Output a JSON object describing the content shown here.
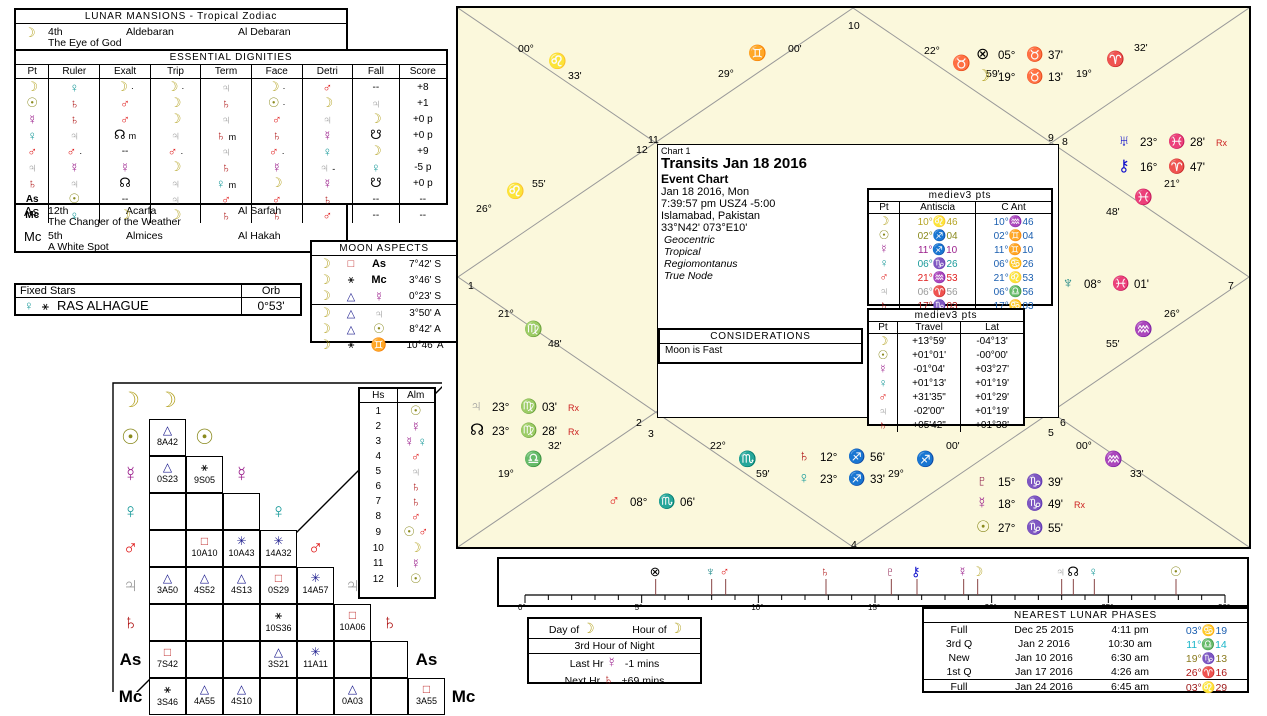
{
  "lunar_mansions": {
    "title": "LUNAR MANSIONS - Tropical Zodiac",
    "rows": [
      {
        "pt": "moon",
        "num": "4th",
        "name": "Aldebaran",
        "alt": "Al Debaran",
        "desc": "The Eye of God"
      },
      {
        "pt": "As",
        "num": "12th",
        "name": "Acarfa",
        "alt": "Al Sarfah",
        "desc": "The Changer of the Weather"
      },
      {
        "pt": "Mc",
        "num": "5th",
        "name": "Almices",
        "alt": "Al Hakah",
        "desc": "A White Spot"
      }
    ]
  },
  "essential_dignities": {
    "title": "ESSENTIAL DIGNITIES",
    "headers": [
      "Pt",
      "Ruler",
      "Exalt",
      "Trip",
      "Term",
      "Face",
      "Detri",
      "Fall",
      "Score"
    ],
    "rows": [
      {
        "pt": "moon",
        "ruler": "venus",
        "exalt": "moon",
        "exalt_m": "·",
        "trip": "moon",
        "trip_m": "·",
        "term": "jupiter",
        "face": "moon",
        "face_m": "·",
        "detri": "mars",
        "fall": "--",
        "score": "+8"
      },
      {
        "pt": "sun",
        "ruler": "saturn",
        "exalt": "mars",
        "trip": "moon",
        "term": "saturn",
        "face": "sun",
        "face_m": "·",
        "detri": "moon",
        "fall": "jupiter",
        "score": "+1"
      },
      {
        "pt": "mercury",
        "ruler": "saturn",
        "exalt": "mars",
        "trip": "moon",
        "term": "jupiter",
        "face": "mars",
        "detri": "jupiter",
        "fall": "moon",
        "score": "+0 p"
      },
      {
        "pt": "venus",
        "ruler": "jupiter",
        "exalt": "node",
        "exalt_m": "m",
        "trip": "jupiter",
        "term": "saturn",
        "term_m": "m",
        "face": "saturn",
        "detri": "mercury",
        "fall": "southnode",
        "score": "+0 p"
      },
      {
        "pt": "mars",
        "ruler": "mars",
        "ruler_m": "·",
        "exalt": "--",
        "trip": "mars",
        "trip_m": "·",
        "term": "jupiter",
        "face": "mars",
        "face_m": "·",
        "detri": "venus",
        "fall": "moon",
        "score": "+9"
      },
      {
        "pt": "jupiter",
        "ruler": "mercury",
        "exalt": "mercury",
        "trip": "moon",
        "term": "saturn",
        "face": "mercury",
        "detri": "jupiter",
        "detri_m": "-",
        "fall": "venus",
        "score": "-5 p"
      },
      {
        "pt": "saturn",
        "ruler": "jupiter",
        "exalt": "node",
        "trip": "jupiter",
        "term": "venus",
        "term_m": "m",
        "face": "moon",
        "detri": "mercury",
        "fall": "southnode",
        "score": "+0 p"
      },
      {
        "pt": "As",
        "ruler": "sun",
        "exalt": "--",
        "trip": "jupiter",
        "term": "mars",
        "face": "mars",
        "detri": "saturn",
        "fall": "--",
        "score": "--"
      },
      {
        "pt": "Mc",
        "ruler": "venus",
        "exalt": "moon",
        "trip": "moon",
        "term": "saturn",
        "face": "saturn",
        "detri": "mars",
        "fall": "--",
        "score": "--"
      }
    ]
  },
  "fixed_stars": {
    "col1": "Fixed Stars",
    "col2": "Orb",
    "rows": [
      {
        "pt": "venus",
        "aspect": "conjunct",
        "star": "RAS ALHAGUE",
        "orb": "0°53'"
      }
    ]
  },
  "moon_aspects": {
    "title": "MOON ASPECTS",
    "rows": [
      {
        "p1": "moon",
        "asp": "square",
        "p2": "As",
        "orb": "7°42' S"
      },
      {
        "p1": "moon",
        "asp": "conjunct",
        "p2": "Mc",
        "orb": "3°46' S"
      },
      {
        "p1": "moon",
        "asp": "trine",
        "p2": "mercury",
        "orb": "0°23' S"
      },
      {
        "p1": "moon",
        "asp": "trine",
        "p2": "jupiter",
        "orb": "3°50' A"
      },
      {
        "p1": "moon",
        "asp": "trine",
        "p2": "sun",
        "orb": "8°42' A"
      },
      {
        "p1": "moon",
        "asp": "conjunct",
        "p2": "gemini",
        "orb": "10°46' A"
      }
    ]
  },
  "aspect_grid": {
    "points": [
      "moon",
      "sun",
      "mercury",
      "venus",
      "mars",
      "jupiter",
      "saturn",
      "As",
      "Mc"
    ],
    "cells": [
      {
        "row": 1,
        "col": 0,
        "asp": "trine",
        "val": "8A42"
      },
      {
        "row": 2,
        "col": 0,
        "asp": "trine",
        "val": "0S23"
      },
      {
        "row": 2,
        "col": 1,
        "asp": "conjunct",
        "val": "9S05"
      },
      {
        "row": 4,
        "col": 1,
        "asp": "square",
        "val": "10A10"
      },
      {
        "row": 4,
        "col": 2,
        "asp": "sextile",
        "val": "10A43"
      },
      {
        "row": 4,
        "col": 3,
        "asp": "sextile",
        "val": "14A32"
      },
      {
        "row": 5,
        "col": 0,
        "asp": "trine",
        "val": "3A50"
      },
      {
        "row": 5,
        "col": 1,
        "asp": "trine",
        "val": "4S52"
      },
      {
        "row": 5,
        "col": 2,
        "asp": "trine",
        "val": "4S13"
      },
      {
        "row": 5,
        "col": 3,
        "asp": "square",
        "val": "0S29"
      },
      {
        "row": 5,
        "col": 4,
        "asp": "sextile",
        "val": "14A57"
      },
      {
        "row": 6,
        "col": 3,
        "asp": "conjunct",
        "val": "10S36"
      },
      {
        "row": 6,
        "col": 5,
        "asp": "square",
        "val": "10A06"
      },
      {
        "row": 7,
        "col": 0,
        "asp": "square",
        "val": "7S42"
      },
      {
        "row": 7,
        "col": 3,
        "asp": "trine",
        "val": "3S21"
      },
      {
        "row": 7,
        "col": 4,
        "asp": "sextile",
        "val": "11A11"
      },
      {
        "row": 8,
        "col": 0,
        "asp": "conjunct",
        "val": "3S46"
      },
      {
        "row": 8,
        "col": 1,
        "asp": "trine",
        "val": "4A55"
      },
      {
        "row": 8,
        "col": 2,
        "asp": "trine",
        "val": "4S10"
      },
      {
        "row": 8,
        "col": 5,
        "asp": "trine",
        "val": "0A03"
      },
      {
        "row": 8,
        "col": 7,
        "asp": "square",
        "val": "3A55"
      }
    ]
  },
  "almuten_table": {
    "headers": [
      "Hs",
      "Alm"
    ],
    "rows": [
      {
        "hs": "1",
        "alm": [
          "sun"
        ]
      },
      {
        "hs": "2",
        "alm": [
          "mercury"
        ]
      },
      {
        "hs": "3",
        "alm": [
          "mercury",
          "venus"
        ]
      },
      {
        "hs": "4",
        "alm": [
          "mars"
        ]
      },
      {
        "hs": "5",
        "alm": [
          "jupiter"
        ]
      },
      {
        "hs": "6",
        "alm": [
          "saturn"
        ]
      },
      {
        "hs": "7",
        "alm": [
          "saturn"
        ]
      },
      {
        "hs": "8",
        "alm": [
          "mars"
        ]
      },
      {
        "hs": "9",
        "alm": [
          "sun",
          "mars"
        ]
      },
      {
        "hs": "10",
        "alm": [
          "moon"
        ]
      },
      {
        "hs": "11",
        "alm": [
          "mercury"
        ]
      },
      {
        "hs": "12",
        "alm": [
          "sun"
        ]
      }
    ]
  },
  "chart_info": {
    "label": "Chart 1",
    "title": "Transits Jan 18 2016",
    "subtitle": "Event Chart",
    "date": "Jan 18 2016, Mon",
    "time": "7:39:57 pm  USZ4 -5:00",
    "place": "Islamabad, Pakistan",
    "coords": "33°N42' 073°E10'",
    "settings": [
      "Geocentric",
      "Tropical",
      "Regiomontanus",
      "True Node"
    ]
  },
  "considerations": {
    "title": "CONSIDERATIONS",
    "items": [
      "Moon is Fast"
    ]
  },
  "antiscia": {
    "title": "mediev3 pts",
    "headers": [
      "Pt",
      "Antiscia",
      "C Ant"
    ],
    "rows": [
      {
        "pt": "moon",
        "ant": "10°",
        "ant_sign": "leo",
        "ant_min": "46",
        "cant": "10°",
        "cant_sign": "aquarius",
        "cant_min": "46"
      },
      {
        "pt": "sun",
        "ant": "02°",
        "ant_sign": "sagittarius",
        "ant_min": "04",
        "cant": "02°",
        "cant_sign": "gemini",
        "cant_min": "04"
      },
      {
        "pt": "mercury",
        "ant": "11°",
        "ant_sign": "sagittarius",
        "ant_min": "10",
        "cant": "11°",
        "cant_sign": "gemini",
        "cant_min": "10"
      },
      {
        "pt": "venus",
        "ant": "06°",
        "ant_sign": "capricorn",
        "ant_min": "26",
        "cant": "06°",
        "cant_sign": "cancer",
        "cant_min": "26"
      },
      {
        "pt": "mars",
        "ant": "21°",
        "ant_sign": "aquarius",
        "ant_min": "53",
        "cant": "21°",
        "cant_sign": "leo",
        "cant_min": "53"
      },
      {
        "pt": "jupiter",
        "ant": "06°",
        "ant_sign": "aries",
        "ant_min": "56",
        "cant": "06°",
        "cant_sign": "libra",
        "cant_min": "56"
      },
      {
        "pt": "saturn",
        "ant": "17°",
        "ant_sign": "capricorn",
        "ant_min": "03",
        "cant": "17°",
        "cant_sign": "cancer",
        "cant_min": "03"
      }
    ]
  },
  "travel": {
    "title": "mediev3 pts",
    "headers": [
      "Pt",
      "Travel",
      "Lat"
    ],
    "rows": [
      {
        "pt": "moon",
        "travel": "+13°59'",
        "lat": "-04°13'"
      },
      {
        "pt": "sun",
        "travel": "+01°01'",
        "lat": "-00°00'"
      },
      {
        "pt": "mercury",
        "travel": "-01°04'",
        "lat": "+03°27'"
      },
      {
        "pt": "venus",
        "travel": "+01°13'",
        "lat": "+01°19'"
      },
      {
        "pt": "mars",
        "travel": "+31'35\"",
        "lat": "+01°29'"
      },
      {
        "pt": "jupiter",
        "travel": "-02'00\"",
        "lat": "+01°19'"
      },
      {
        "pt": "saturn",
        "travel": "+05'42\"",
        "lat": "+01°38'"
      }
    ]
  },
  "wheel": {
    "house_numbers": [
      "1",
      "2",
      "3",
      "4",
      "5",
      "6",
      "7",
      "8",
      "9",
      "10",
      "11",
      "12"
    ],
    "cusps": [
      {
        "house": "10",
        "deg": "22°",
        "sign": "taurus",
        "min": "59'"
      },
      {
        "house": "11",
        "deg": "29°",
        "sign": "gemini",
        "min": "00'"
      },
      {
        "house": "12",
        "deg": "00°",
        "sign": "leo",
        "min": "33'"
      },
      {
        "house": "1",
        "deg": "26°",
        "sign": "leo",
        "min": "55'"
      },
      {
        "house": "2",
        "deg": "21°",
        "sign": "virgo",
        "min": "48'"
      },
      {
        "house": "3",
        "deg": "19°",
        "sign": "libra",
        "min": "32'"
      },
      {
        "house": "4",
        "deg": "22°",
        "sign": "scorpio",
        "min": "59'"
      },
      {
        "house": "5",
        "deg": "29°",
        "sign": "sagittarius",
        "min": "00'"
      },
      {
        "house": "6",
        "deg": "00°",
        "sign": "aquarius",
        "min": "33'"
      },
      {
        "house": "7",
        "deg": "26°",
        "sign": "aquarius",
        "min": "55'"
      },
      {
        "house": "8",
        "deg": "21°",
        "sign": "pisces",
        "min": "48'"
      },
      {
        "house": "9",
        "deg": "19°",
        "sign": "aries",
        "min": "32'"
      }
    ],
    "planets": [
      {
        "pt": "partfortune",
        "deg": "05°",
        "sign": "taurus",
        "min": "37'",
        "rx": ""
      },
      {
        "pt": "moon",
        "deg": "19°",
        "sign": "taurus",
        "min": "13'",
        "rx": ""
      },
      {
        "pt": "uranus",
        "deg": "23°",
        "sign": "pisces",
        "min": "28'",
        "rx": "Rx"
      },
      {
        "pt": "chiron",
        "deg": "16°",
        "sign": "aries",
        "min": "47'",
        "rx": ""
      },
      {
        "pt": "neptune",
        "deg": "08°",
        "sign": "pisces",
        "min": "01'",
        "rx": ""
      },
      {
        "pt": "pluto",
        "deg": "15°",
        "sign": "capricorn",
        "min": "39'",
        "rx": ""
      },
      {
        "pt": "mercury",
        "deg": "18°",
        "sign": "capricorn",
        "min": "49'",
        "rx": "Rx"
      },
      {
        "pt": "sun",
        "deg": "27°",
        "sign": "capricorn",
        "min": "55'",
        "rx": ""
      },
      {
        "pt": "saturn",
        "deg": "12°",
        "sign": "sagittarius",
        "min": "56'",
        "rx": ""
      },
      {
        "pt": "venus",
        "deg": "23°",
        "sign": "sagittarius",
        "min": "33'",
        "rx": ""
      },
      {
        "pt": "mars",
        "deg": "08°",
        "sign": "scorpio",
        "min": "06'",
        "rx": ""
      },
      {
        "pt": "jupiter",
        "deg": "23°",
        "sign": "virgo",
        "min": "03'",
        "rx": "Rx"
      },
      {
        "pt": "northnode",
        "deg": "23°",
        "sign": "virgo",
        "min": "28'",
        "rx": "Rx"
      }
    ]
  },
  "dial": {
    "ticks": [
      "0°",
      "5°",
      "10°",
      "15°",
      "20°",
      "25°",
      "30°"
    ],
    "markers": [
      {
        "pt": "partfortune",
        "pos": 5.6
      },
      {
        "pt": "neptune",
        "pos": 8.0
      },
      {
        "pt": "mars",
        "pos": 8.6
      },
      {
        "pt": "saturn",
        "pos": 12.9
      },
      {
        "pt": "pluto",
        "pos": 15.7
      },
      {
        "pt": "chiron",
        "pos": 16.8
      },
      {
        "pt": "mercury",
        "pos": 18.8
      },
      {
        "pt": "moon",
        "pos": 19.4
      },
      {
        "pt": "jupiter",
        "pos": 23.0
      },
      {
        "pt": "northnode",
        "pos": 23.5
      },
      {
        "pt": "venus",
        "pos": 24.4
      },
      {
        "pt": "sun",
        "pos": 27.9
      }
    ]
  },
  "hour_panel": {
    "day_of_label": "Day of",
    "day_of_pt": "moon",
    "hour_of_label": "Hour of",
    "hour_of_pt": "moon",
    "current": "3rd Hour of Night",
    "last_label": "Last Hr",
    "last_pt": "mercury",
    "last_val": "-1 mins",
    "next_label": "Next Hr",
    "next_pt": "saturn",
    "next_val": "+69 mins"
  },
  "lunar_phases": {
    "title": "NEAREST LUNAR PHASES",
    "rows": [
      {
        "phase": "Full",
        "date": "Dec 25 2015",
        "time": "4:11 pm",
        "deg": "03°",
        "sign": "cancer",
        "min": "19"
      },
      {
        "phase": "3rd Q",
        "date": "Jan 2 2016",
        "time": "10:30 am",
        "deg": "11°",
        "sign": "libra",
        "min": "14"
      },
      {
        "phase": "New",
        "date": "Jan 10 2016",
        "time": "6:30 am",
        "deg": "19°",
        "sign": "capricorn",
        "min": "13"
      },
      {
        "phase": "1st Q",
        "date": "Jan 17 2016",
        "time": "4:26 am",
        "deg": "26°",
        "sign": "aries",
        "min": "16"
      },
      {
        "phase": "Full",
        "date": "Jan 24 2016",
        "time": "6:45 am",
        "deg": "03°",
        "sign": "leo",
        "min": "29"
      }
    ]
  }
}
